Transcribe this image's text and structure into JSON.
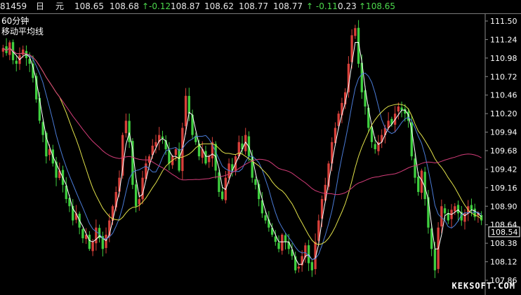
{
  "quote_bar": {
    "code": "81459",
    "unit1": "日",
    "unit2": "元",
    "v1": "108.65",
    "v2": "108.68",
    "ch1": "↑-0.12",
    "v3": "108.87",
    "v4": "108.62",
    "v5": "108.77",
    "v6": "108.77",
    "ch2": "↑ -0.11",
    "v7": "0.23",
    "ch3": "↑108.65"
  },
  "chart_labels": {
    "period": "60分钟",
    "indicator": "移动平均线"
  },
  "watermark": "KEKSOFT.COM",
  "colors": {
    "background": "#000000",
    "up_candle": "#d8403a",
    "down_candle": "#3fcf3f",
    "ma_fast_white": "#ffffff",
    "ma_blue": "#4a7bd6",
    "ma_yellow": "#e2e24a",
    "ma_pink": "#d23c78",
    "current_price_box": "#ffffff"
  },
  "chart_data": {
    "type": "candlestick",
    "y_ticks": [
      "111.50",
      "111.24",
      "110.98",
      "110.72",
      "110.46",
      "110.20",
      "109.94",
      "109.68",
      "109.42",
      "109.16",
      "108.90",
      "108.64",
      "108.38",
      "108.12",
      "107.86"
    ],
    "ylim": [
      107.86,
      111.5
    ],
    "current_price": "108.54",
    "close": [
      111.12,
      111.05,
      111.2,
      110.95,
      110.9,
      111.02,
      111.1,
      110.98,
      110.9,
      110.7,
      110.4,
      110.1,
      109.9,
      109.6,
      109.7,
      109.5,
      109.3,
      109.4,
      109.2,
      109.0,
      108.9,
      108.7,
      108.8,
      108.6,
      108.45,
      108.5,
      108.3,
      108.4,
      108.6,
      108.45,
      108.3,
      108.5,
      108.7,
      108.9,
      109.1,
      109.3,
      109.9,
      110.1,
      109.8,
      109.2,
      108.9,
      109.0,
      109.3,
      109.5,
      109.6,
      109.75,
      109.8,
      109.9,
      109.85,
      109.7,
      109.5,
      109.6,
      109.7,
      109.4,
      110.0,
      110.45,
      110.2,
      109.9,
      109.8,
      109.6,
      109.7,
      109.5,
      109.6,
      109.8,
      109.4,
      109.1,
      109.0,
      109.3,
      109.5,
      109.4,
      109.6,
      109.8,
      109.7,
      109.9,
      109.6,
      109.3,
      109.2,
      109.0,
      108.8,
      108.7,
      108.6,
      108.5,
      108.4,
      108.3,
      108.5,
      108.4,
      108.3,
      108.2,
      108.0,
      108.05,
      108.2,
      108.35,
      108.1,
      108.0,
      108.4,
      108.7,
      109.0,
      109.2,
      109.5,
      109.8,
      110.0,
      110.2,
      110.35,
      110.5,
      110.9,
      111.3,
      111.4,
      110.9,
      110.5,
      110.3,
      110.0,
      109.8,
      109.7,
      109.8,
      109.9,
      110.0,
      110.1,
      110.05,
      110.2,
      110.3,
      110.25,
      110.2,
      110.1,
      109.6,
      109.3,
      109.1,
      109.4,
      109.0,
      108.6,
      108.3,
      108.0,
      108.6,
      108.9,
      108.8,
      108.7,
      108.85,
      108.9,
      108.8,
      108.7,
      108.8,
      108.9,
      108.85,
      108.75,
      108.8,
      108.7
    ]
  }
}
